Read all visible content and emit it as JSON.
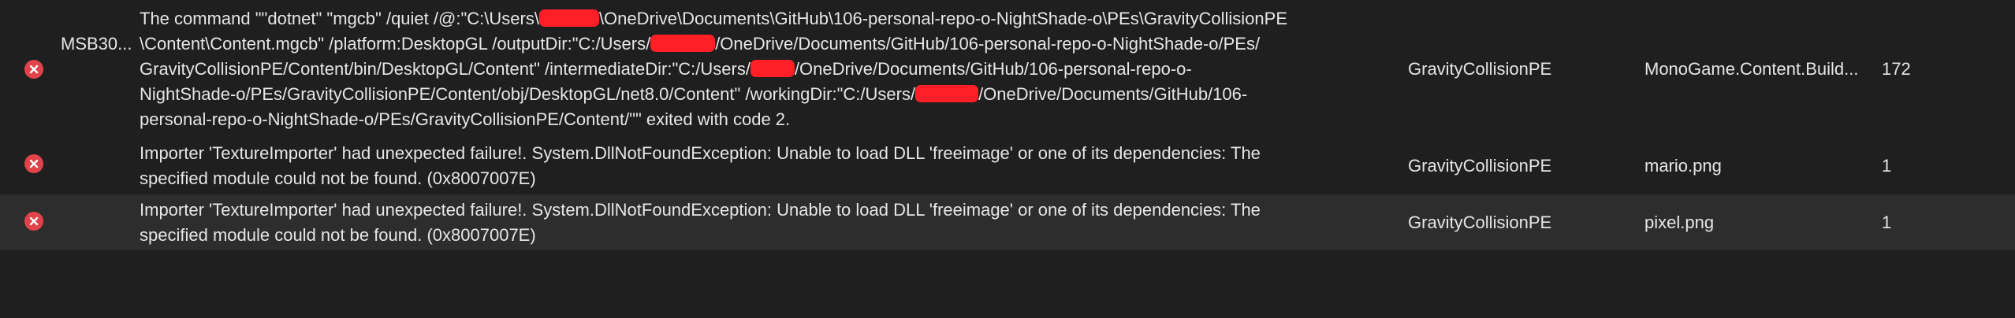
{
  "rows": [
    {
      "severity_icon": "error-circle-icon",
      "code": "MSB30...",
      "description_lines": [
        [
          "The command \"\"dotnet\" \"mgcb\" /quiet /@:\"C:\\Users\\",
          "\\OneDrive\\Documents\\GitHub\\106-personal-repo-o-NightShade-o\\PEs\\GravityCollisionPE"
        ],
        [
          "\\Content\\Content.mgcb\" /platform:DesktopGL /outputDir:\"C:/Users/",
          "/OneDrive/Documents/GitHub/106-personal-repo-o-NightShade-o/PEs/"
        ],
        [
          "GravityCollisionPE/Content/bin/DesktopGL/Content\" /intermediateDir:\"C:/Users/",
          "/OneDrive/Documents/GitHub/106-personal-repo-o-"
        ],
        [
          "NightShade-o/PEs/GravityCollisionPE/Content/obj/DesktopGL/net8.0/Content\" /workingDir:\"C:/Users/",
          "/OneDrive/Documents/GitHub/106-"
        ],
        [
          "personal-repo-o-NightShade-o/PEs/GravityCollisionPE/Content/\"\" exited with code 2."
        ]
      ],
      "project": "GravityCollisionPE",
      "file": "MonoGame.Content.Build...",
      "line": "172"
    },
    {
      "severity_icon": "error-circle-icon",
      "code": "",
      "description_lines": [
        [
          "Importer 'TextureImporter' had unexpected failure!. System.DllNotFoundException: Unable to load DLL 'freeimage' or one of its dependencies: The"
        ],
        [
          "specified module could not be found. (0x8007007E)"
        ]
      ],
      "project": "GravityCollisionPE",
      "file": "mario.png",
      "line": "1"
    },
    {
      "severity_icon": "error-circle-icon",
      "code": "",
      "description_lines": [
        [
          "Importer 'TextureImporter' had unexpected failure!. System.DllNotFoundException: Unable to load DLL 'freeimage' or one of its dependencies: The"
        ],
        [
          "specified module could not be found. (0x8007007E)"
        ]
      ],
      "project": "GravityCollisionPE",
      "file": "pixel.png",
      "line": "1"
    }
  ],
  "colors": {
    "background": "#1f1f1f",
    "selected_row": "#2d2d2d",
    "error_icon": "#e0444a",
    "redaction": "#ff1f26",
    "text": "#e6e6e6"
  }
}
